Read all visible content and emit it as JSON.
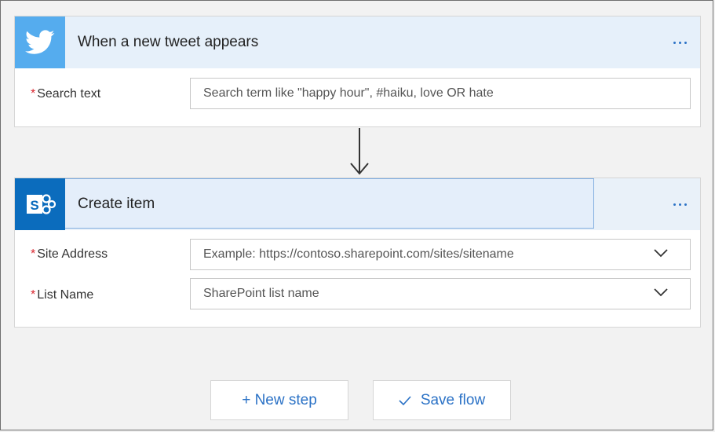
{
  "trigger": {
    "icon": "twitter-bird-icon",
    "icon_color": "#55acee",
    "title": "When a new tweet appears",
    "fields": {
      "search_text": {
        "required_mark": "*",
        "label": "Search text",
        "placeholder": "Search term like \"happy hour\", #haiku, love OR hate",
        "value": ""
      }
    }
  },
  "connector": {
    "icon": "arrow-down-icon"
  },
  "action": {
    "icon": "sharepoint-icon",
    "icon_color": "#0b6cbd",
    "icon_letter": "S",
    "title": "Create item",
    "fields": {
      "site_address": {
        "required_mark": "*",
        "label": "Site Address",
        "placeholder": "Example: https://contoso.sharepoint.com/sites/sitename"
      },
      "list_name": {
        "required_mark": "*",
        "label": "List Name",
        "placeholder": "SharePoint list name"
      }
    }
  },
  "footer": {
    "new_step_label": "+ New step",
    "save_flow_label": "Save flow",
    "save_icon": "checkmark-icon"
  },
  "colors": {
    "accent": "#2b72c6",
    "required": "#d9262f",
    "header_bg": "#e6f0fa"
  }
}
